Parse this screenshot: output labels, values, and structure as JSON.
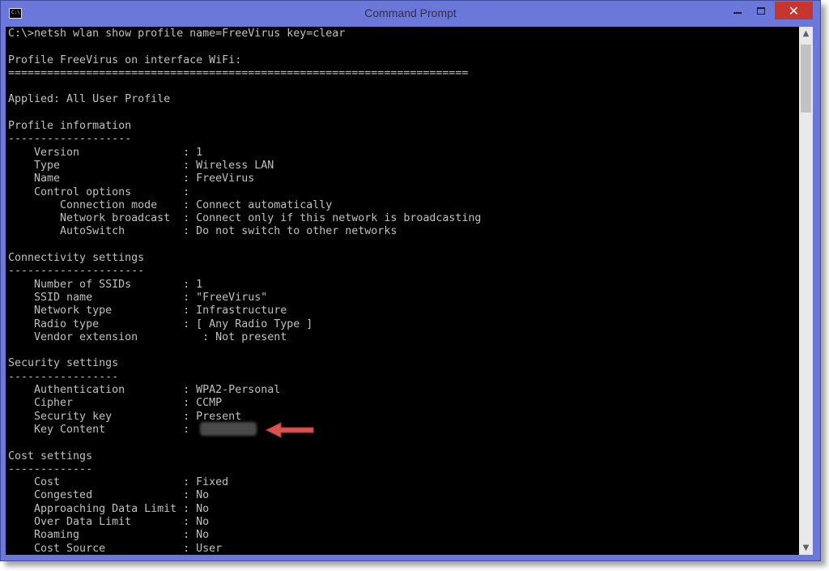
{
  "window": {
    "title": "Command Prompt",
    "icon": "C:\\",
    "close_label": "✕"
  },
  "console": {
    "lines": [
      "C:\\>netsh wlan show profile name=FreeVirus key=clear",
      "",
      "Profile FreeVirus on interface WiFi:",
      "=======================================================================",
      "",
      "Applied: All User Profile",
      "",
      "Profile information",
      "-------------------",
      "    Version                : 1",
      "    Type                   : Wireless LAN",
      "    Name                   : FreeVirus",
      "    Control options        :",
      "        Connection mode    : Connect automatically",
      "        Network broadcast  : Connect only if this network is broadcasting",
      "        AutoSwitch         : Do not switch to other networks",
      "",
      "Connectivity settings",
      "---------------------",
      "    Number of SSIDs        : 1",
      "    SSID name              : \"FreeVirus\"",
      "    Network type           : Infrastructure",
      "    Radio type             : [ Any Radio Type ]",
      "    Vendor extension          : Not present",
      "",
      "Security settings",
      "-----------------",
      "    Authentication         : WPA2-Personal",
      "    Cipher                 : CCMP",
      "    Security key           : Present",
      "    Key Content            :",
      "",
      "Cost settings",
      "-------------",
      "    Cost                   : Fixed",
      "    Congested              : No",
      "    Approaching Data Limit : No",
      "    Over Data Limit        : No",
      "    Roaming                : No",
      "    Cost Source            : User"
    ]
  },
  "colors": {
    "titlebar": "#6c78d9",
    "console_bg": "#000000",
    "console_fg": "#c0c0c0",
    "close_button": "#c6362f",
    "arrow": "#d9534f"
  }
}
